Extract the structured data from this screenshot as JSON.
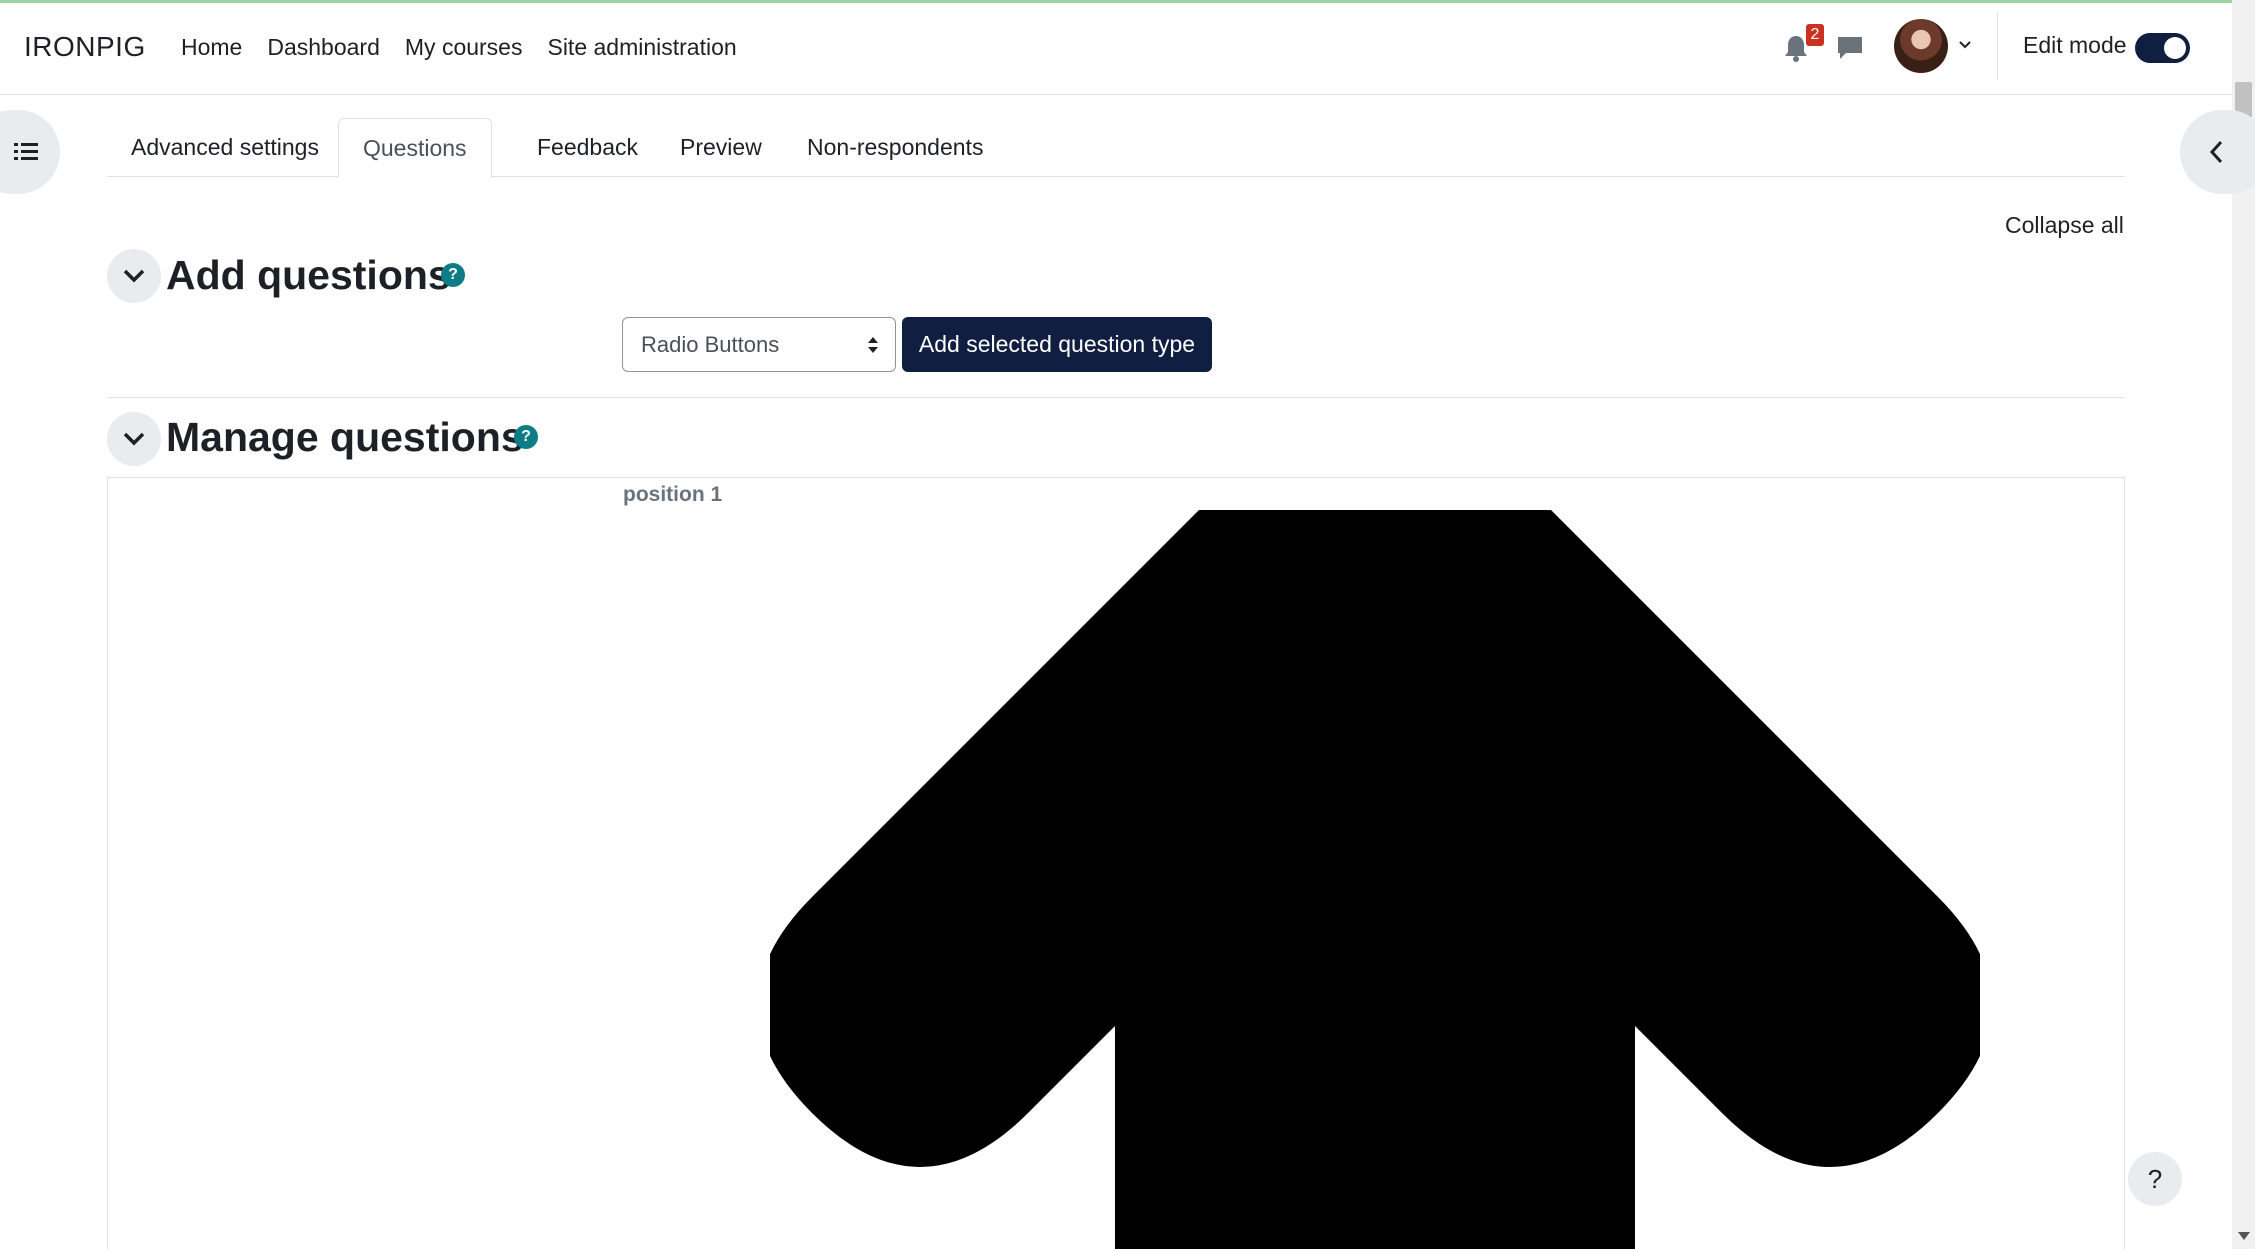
{
  "navbar": {
    "brand": "IRONPIG",
    "links": [
      "Home",
      "Dashboard",
      "My courses",
      "Site administration"
    ],
    "notification_count": "2",
    "edit_mode_label": "Edit mode",
    "edit_mode_on": true
  },
  "tabs": [
    {
      "label": "Advanced settings",
      "active": false
    },
    {
      "label": "Questions",
      "active": true
    },
    {
      "label": "Feedback",
      "active": false
    },
    {
      "label": "Preview",
      "active": false
    },
    {
      "label": "Non-respondents",
      "active": false
    }
  ],
  "collapse_all": "Collapse all",
  "add_questions": {
    "title": "Add questions",
    "help": "?",
    "select_value": "Radio Buttons",
    "button_label": "Add selected question type"
  },
  "manage_questions": {
    "title": "Manage questions",
    "help": "?",
    "position_label": "position 1"
  },
  "help_button": "?",
  "colors": {
    "primary_dark": "#0f1e41",
    "help_icon": "#0e7c86",
    "badge": "#ca3120"
  },
  "icons": [
    "bell-icon",
    "message-icon",
    "list-icon",
    "chevron-left-icon",
    "chevron-down-icon",
    "arrow-up-icon",
    "question-icon"
  ]
}
